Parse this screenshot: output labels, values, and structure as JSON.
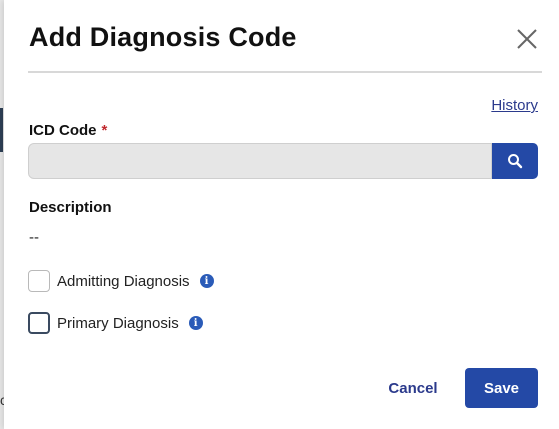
{
  "dialog": {
    "title": "Add Diagnosis Code",
    "close_icon": "close-icon",
    "history_link": "History"
  },
  "icd_field": {
    "label": "ICD Code",
    "required_marker": "*",
    "value": "",
    "placeholder": "",
    "search_icon": "search-icon"
  },
  "description": {
    "label": "Description",
    "value": "--"
  },
  "checkboxes": [
    {
      "label": "Admitting Diagnosis",
      "checked": false,
      "info_icon": "info-icon"
    },
    {
      "label": "Primary Diagnosis",
      "checked": false,
      "info_icon": "info-icon"
    }
  ],
  "actions": {
    "cancel_label": "Cancel",
    "save_label": "Save"
  },
  "colors": {
    "primary": "#2449a6",
    "link": "#2b3a8c",
    "required": "#c0282d",
    "info": "#2a5bb8"
  }
}
